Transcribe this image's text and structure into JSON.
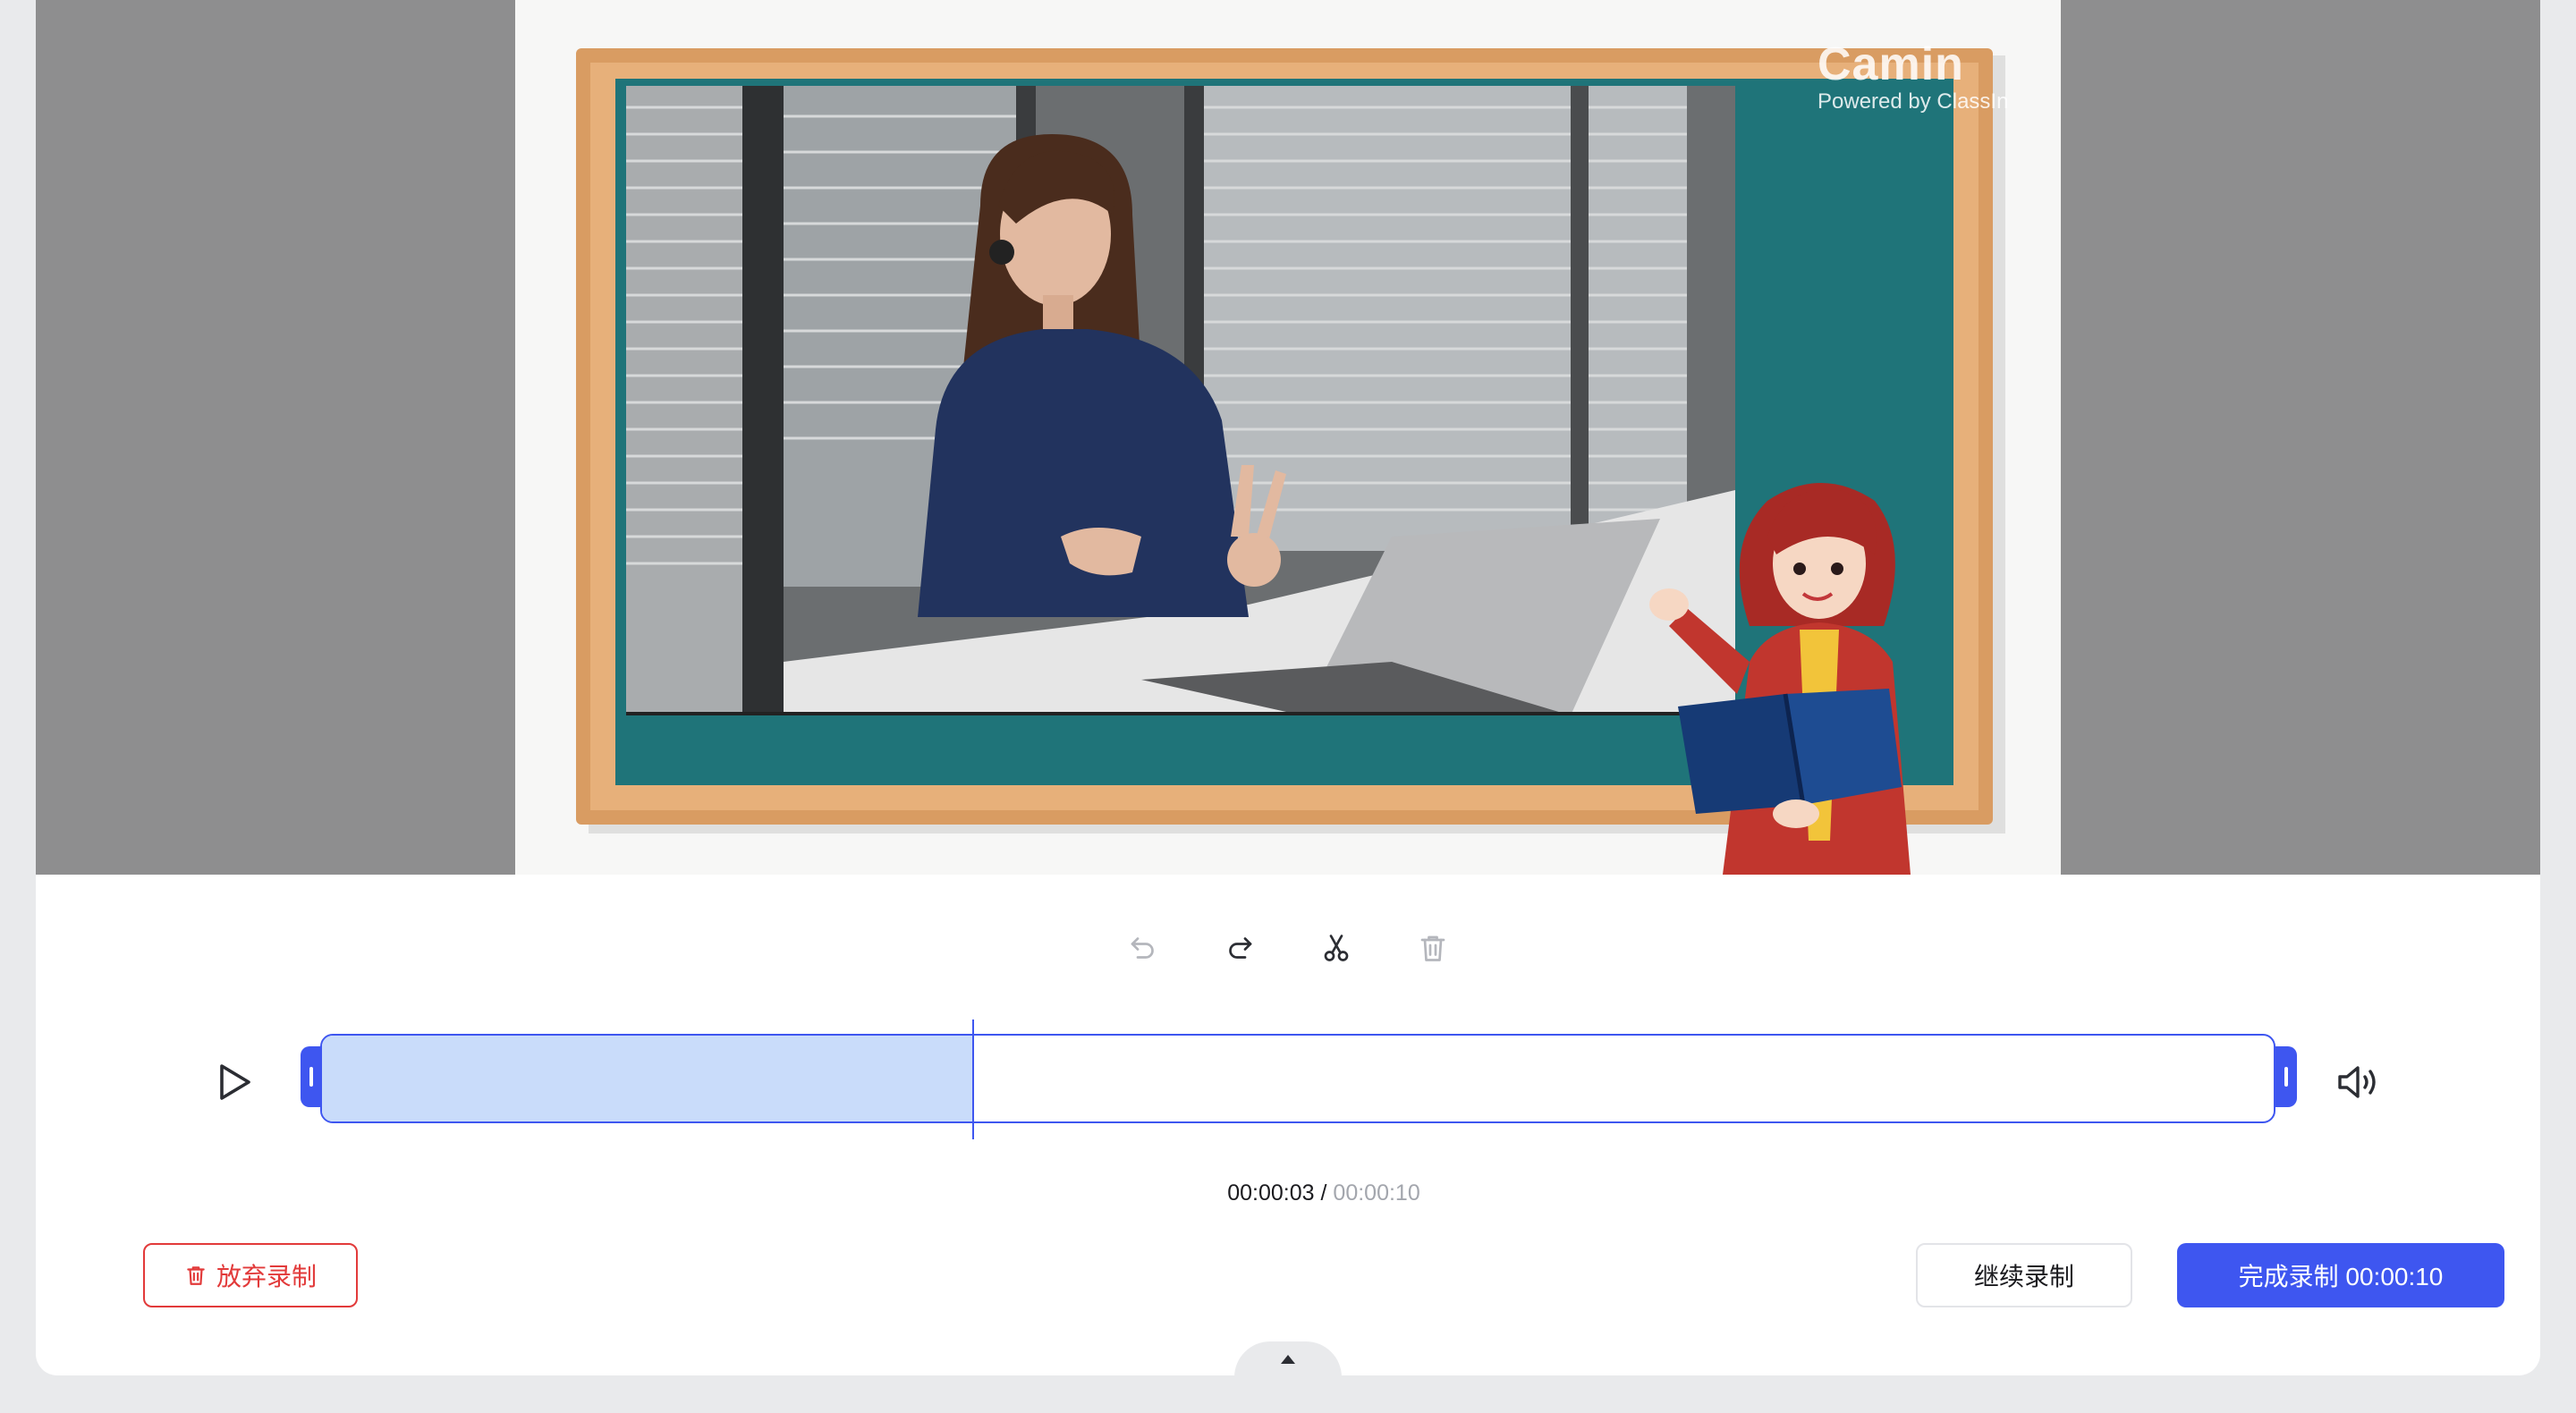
{
  "watermark": {
    "logo": "Camin",
    "powered_by": "Powered by ClassIn"
  },
  "toolbar": {
    "icons": [
      "undo-icon",
      "redo-icon",
      "scissors-icon",
      "trash-icon"
    ]
  },
  "timeline": {
    "current_time": "00:00:03",
    "separator": " / ",
    "total_time": "00:00:10",
    "progress_fraction": 0.3333
  },
  "buttons": {
    "discard_label": "放弃录制",
    "continue_label": "继续录制",
    "finish_label": "完成录制 00:00:10"
  },
  "colors": {
    "accent": "#3e56f0",
    "danger": "#e23a3a",
    "progress_fill": "#c9dcfa",
    "preview_bg": "#8e8e8f"
  }
}
